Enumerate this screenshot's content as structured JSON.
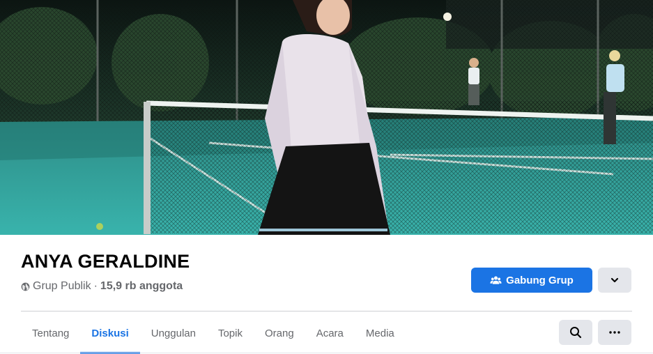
{
  "cover": {
    "alt_subject": "cover-photo"
  },
  "group": {
    "name": "ANYA GERALDINE",
    "privacy": "Grup Publik",
    "separator": "·",
    "members": "15,9 rb anggota"
  },
  "actions": {
    "join_label": "Gabung Grup"
  },
  "tabs": [
    {
      "label": "Tentang"
    },
    {
      "label": "Diskusi"
    },
    {
      "label": "Unggulan"
    },
    {
      "label": "Topik"
    },
    {
      "label": "Orang"
    },
    {
      "label": "Acara"
    },
    {
      "label": "Media"
    }
  ],
  "active_tab": "Diskusi",
  "colors": {
    "accent": "#1b74e4",
    "secondary_button": "#e4e6eb",
    "muted_text": "#65676b"
  },
  "icons": {
    "privacy": "globe-icon",
    "join": "group-icon",
    "more": "chevron-down-icon",
    "search": "search-icon",
    "overflow": "ellipsis-icon"
  }
}
